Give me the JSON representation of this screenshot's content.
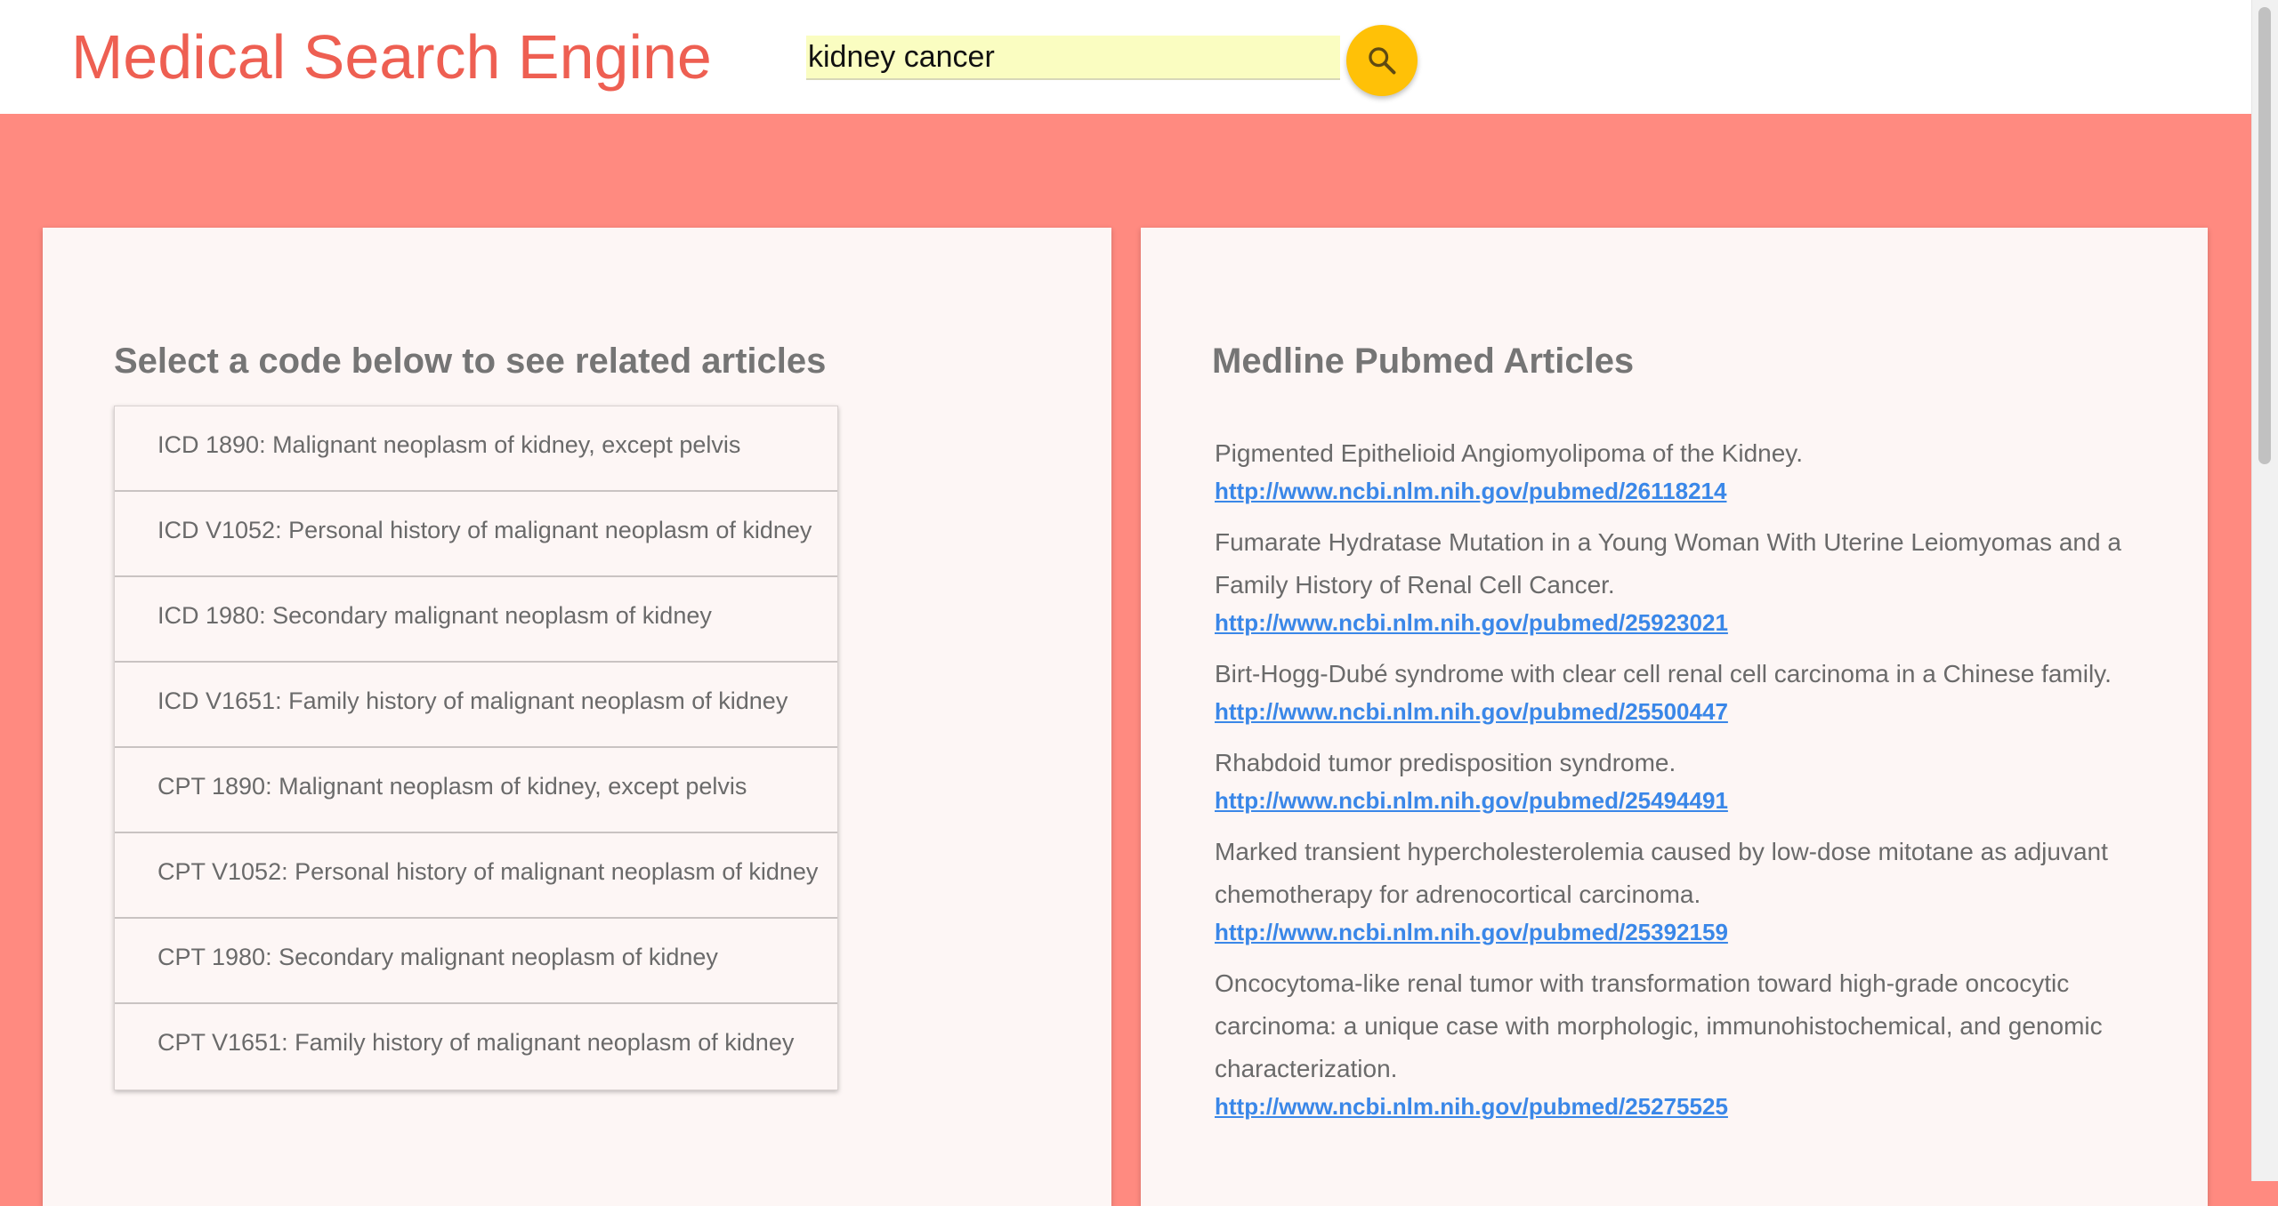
{
  "header": {
    "title": "Medical Search Engine",
    "search_value": "kidney cancer",
    "search_icon": "search-icon"
  },
  "colors": {
    "accent": "#ee5f52",
    "background": "#ff8a80",
    "search_button": "#ffc107",
    "search_field": "#fafdc1",
    "link": "#3a87e8"
  },
  "codes_panel": {
    "title": "Select a code below to see related articles",
    "items": [
      {
        "label": "ICD 1890: Malignant neoplasm of kidney, except pelvis"
      },
      {
        "label": "ICD V1052: Personal history of malignant neoplasm of kidney"
      },
      {
        "label": "ICD 1980: Secondary malignant neoplasm of kidney"
      },
      {
        "label": "ICD V1651: Family history of malignant neoplasm of kidney"
      },
      {
        "label": "CPT 1890: Malignant neoplasm of kidney, except pelvis"
      },
      {
        "label": "CPT V1052: Personal history of malignant neoplasm of kidney"
      },
      {
        "label": "CPT 1980: Secondary malignant neoplasm of kidney"
      },
      {
        "label": "CPT V1651: Family history of malignant neoplasm of kidney"
      }
    ]
  },
  "articles_panel": {
    "title": "Medline Pubmed Articles",
    "articles": [
      {
        "title": "Pigmented Epithelioid Angiomyolipoma of the Kidney.",
        "url": "http://www.ncbi.nlm.nih.gov/pubmed/26118214"
      },
      {
        "title": "Fumarate Hydratase Mutation in a Young Woman With Uterine Leiomyomas and a Family History of Renal Cell Cancer.",
        "url": "http://www.ncbi.nlm.nih.gov/pubmed/25923021"
      },
      {
        "title": "Birt-Hogg-Dubé syndrome with clear cell renal cell carcinoma in a Chinese family.",
        "url": "http://www.ncbi.nlm.nih.gov/pubmed/25500447"
      },
      {
        "title": "Rhabdoid tumor predisposition syndrome.",
        "url": "http://www.ncbi.nlm.nih.gov/pubmed/25494491"
      },
      {
        "title": "Marked transient hypercholesterolemia caused by low-dose mitotane as adjuvant chemotherapy for adrenocortical carcinoma.",
        "url": "http://www.ncbi.nlm.nih.gov/pubmed/25392159"
      },
      {
        "title": "Oncocytoma-like renal tumor with transformation toward high-grade oncocytic carcinoma: a unique case with morphologic, immunohistochemical, and genomic characterization.",
        "url": "http://www.ncbi.nlm.nih.gov/pubmed/25275525"
      }
    ]
  }
}
